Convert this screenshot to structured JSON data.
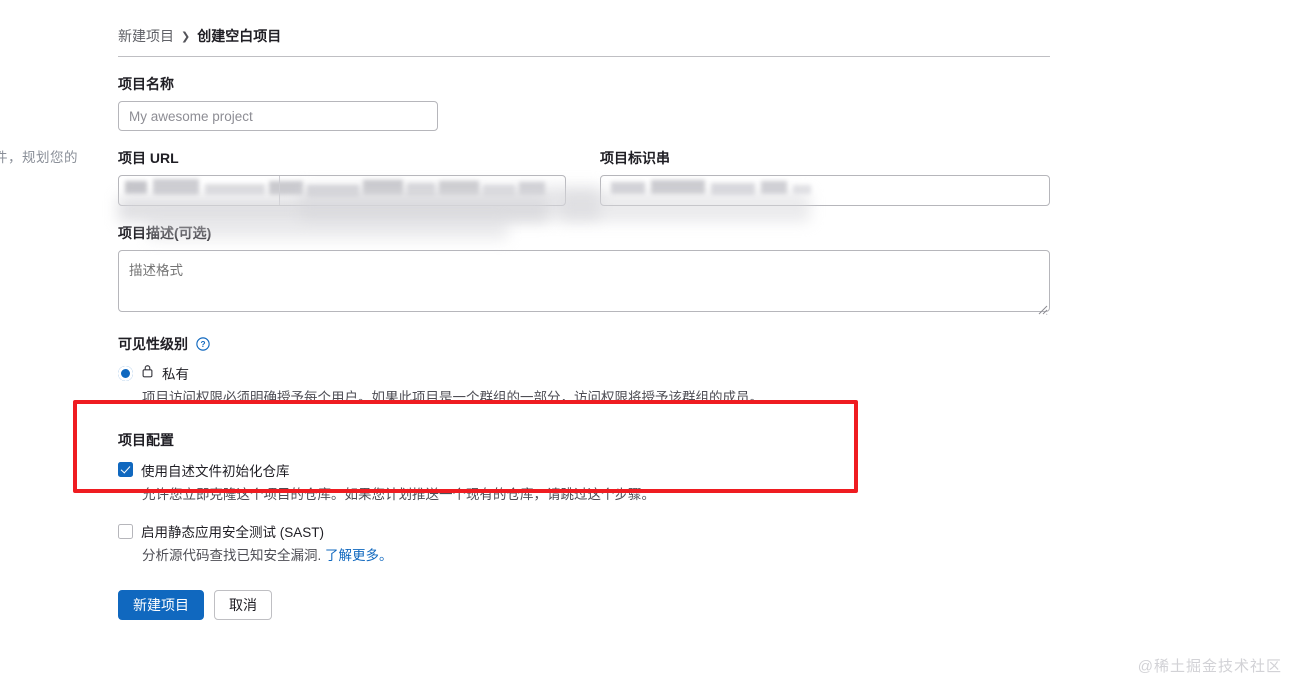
{
  "page": {
    "background_color": "#ffffff",
    "accent_color": "#1068bf",
    "highlight_color": "#ef1c21"
  },
  "left_fragment": {
    "text": "件，规划您的"
  },
  "breadcrumb": {
    "parent": "新建项目",
    "separator": "❯",
    "current": "创建空白项目"
  },
  "form": {
    "project_name": {
      "label": "项目名称",
      "placeholder": "My awesome project",
      "value": ""
    },
    "project_url": {
      "label": "项目 URL",
      "value": "",
      "redacted": true
    },
    "project_slug": {
      "label": "项目标识串",
      "value": "",
      "redacted": true
    },
    "description": {
      "label": "项目描述(可选)",
      "placeholder": "描述格式",
      "value": ""
    },
    "visibility": {
      "label": "可见性级别",
      "help_icon": "question-circle-icon",
      "options": [
        {
          "id": "private",
          "icon": "lock-icon",
          "label": "私有",
          "selected": true,
          "description": "项目访问权限必须明确授予每个用户。如果此项目是一个群组的一部分，访问权限将授予该群组的成员。"
        }
      ]
    },
    "project_configuration": {
      "title": "项目配置",
      "highlighted": true,
      "readme": {
        "label": "使用自述文件初始化仓库",
        "checked": true,
        "description": "允许您立即克隆这个项目的仓库。如果您计划推送一个现有的仓库，请跳过这个步骤。"
      }
    },
    "sast": {
      "label": "启用静态应用安全测试 (SAST)",
      "checked": false,
      "description": "分析源代码查找已知安全漏洞.",
      "link_text": "了解更多。"
    },
    "actions": {
      "submit": "新建项目",
      "cancel": "取消"
    }
  },
  "watermark": {
    "text": "@稀土掘金技术社区"
  }
}
